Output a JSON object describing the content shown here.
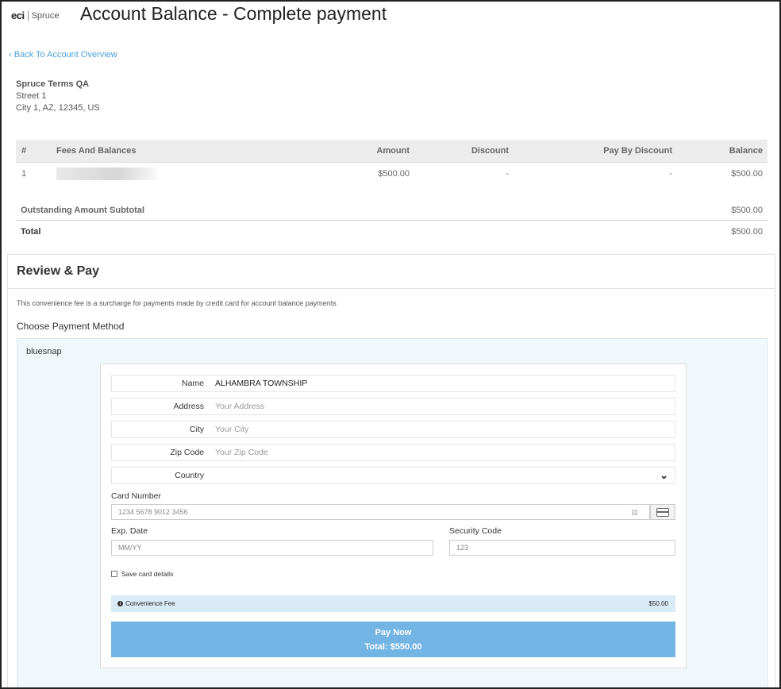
{
  "brand": {
    "eci": "eci",
    "spruce": "Spruce"
  },
  "page": {
    "title": "Account Balance - Complete payment"
  },
  "back_link": "Back To Account Overview",
  "account": {
    "name": "Spruce Terms QA",
    "street": "Street 1",
    "city_line": "City 1, AZ, 12345, US"
  },
  "fees_table": {
    "headers": {
      "num": "#",
      "fee": "Fees And Balances",
      "amount": "Amount",
      "discount": "Discount",
      "pay_by_discount": "Pay By Discount",
      "balance": "Balance"
    },
    "rows": [
      {
        "num": "1",
        "amount": "$500.00",
        "discount": "-",
        "pay_by_discount": "-",
        "balance": "$500.00"
      }
    ]
  },
  "subtotal": {
    "label": "Outstanding Amount Subtotal",
    "value": "$500.00"
  },
  "total": {
    "label": "Total",
    "value": "$500.00"
  },
  "review": {
    "title": "Review & Pay",
    "fee_note": "This convenience fee is a surcharge for payments made by credit card for account balance payments",
    "choose_label": "Choose Payment Method",
    "provider": "bluesnap"
  },
  "form": {
    "name": {
      "label": "Name",
      "value": "ALHAMBRA TOWNSHIP"
    },
    "address": {
      "label": "Address",
      "placeholder": "Your Address"
    },
    "city": {
      "label": "City",
      "placeholder": "Your City"
    },
    "zip": {
      "label": "Zip Code",
      "placeholder": "Your Zip Code"
    },
    "country": {
      "label": "Country",
      "value": ""
    },
    "card_number": {
      "label": "Card Number",
      "placeholder": "1234 5678 9012 3456"
    },
    "exp_date": {
      "label": "Exp. Date",
      "placeholder": "MM/YY"
    },
    "security_code": {
      "label": "Security Code",
      "placeholder": "123"
    },
    "save_card": "Save card details",
    "convenience_fee": {
      "label": "Convenience Fee",
      "value": "$50.00"
    },
    "pay": {
      "label": "Pay Now",
      "total": "Total: $550.00"
    }
  },
  "colors": {
    "link": "#4a9fd8",
    "pay_button": "#72b4e3",
    "fee_bar": "#d9ebf6",
    "panel_bg": "#f1f8fb"
  }
}
